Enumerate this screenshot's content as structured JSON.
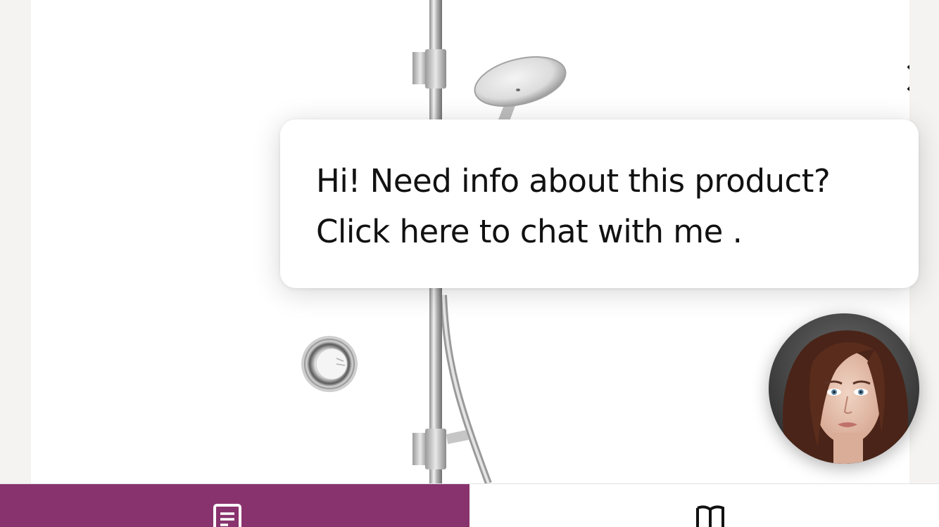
{
  "chat": {
    "line1": "Hi! Need info about this product?",
    "line2": "Click here to chat with me ."
  },
  "icons": {
    "close": "close-icon",
    "avatar": "assistant-avatar",
    "details_tab": "document-icon",
    "catalog_tab": "book-icon"
  },
  "colors": {
    "accent": "#88336d",
    "page_background": "#f4f3f1",
    "card_background": "#ffffff",
    "text": "#111111"
  },
  "tabs": {
    "active_index": 0
  }
}
